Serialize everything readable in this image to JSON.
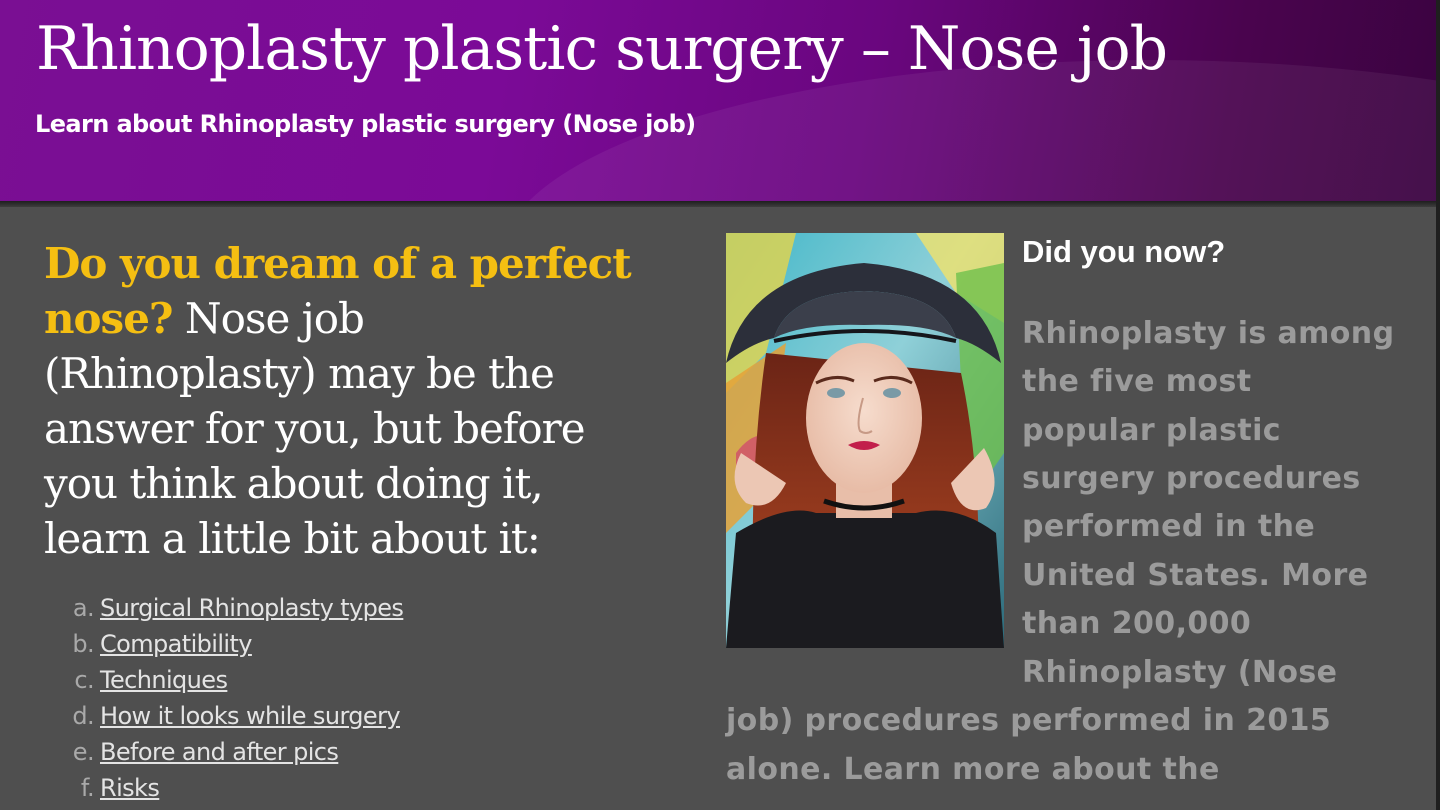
{
  "header": {
    "title": "Rhinoplasty plastic surgery – Nose job",
    "subtitle": "Learn about Rhinoplasty plastic surgery (Nose job)"
  },
  "intro": {
    "highlight": "Do you dream of a perfect nose?",
    "text": " Nose job (Rhinoplasty) may be the answer for you, but before you think about doing it, learn a little bit about it:"
  },
  "toc": [
    {
      "marker": "a.",
      "label": "Surgical Rhinoplasty types"
    },
    {
      "marker": "b.",
      "label": "Compatibility"
    },
    {
      "marker": "c.",
      "label": "Techniques"
    },
    {
      "marker": "d.",
      "label": "How it looks while surgery"
    },
    {
      "marker": "e.",
      "label": "Before and after pics"
    },
    {
      "marker": "f.",
      "label": "Risks"
    }
  ],
  "sidebar": {
    "title": "Did you now?",
    "fact_lines": [
      "Rhinoplasty is among",
      "the five most",
      "popular plastic",
      "surgery procedures",
      "performed in the",
      "United States. More",
      "than 200,000",
      "Rhinoplasty (Nose",
      "job) procedures performed in 2015",
      "alone. Learn more about the"
    ]
  },
  "colors": {
    "header_purple": "#7b0a97",
    "background": "#4f4f4f",
    "highlight_yellow": "#f5bf12",
    "fact_gray": "#9b9b9b"
  }
}
